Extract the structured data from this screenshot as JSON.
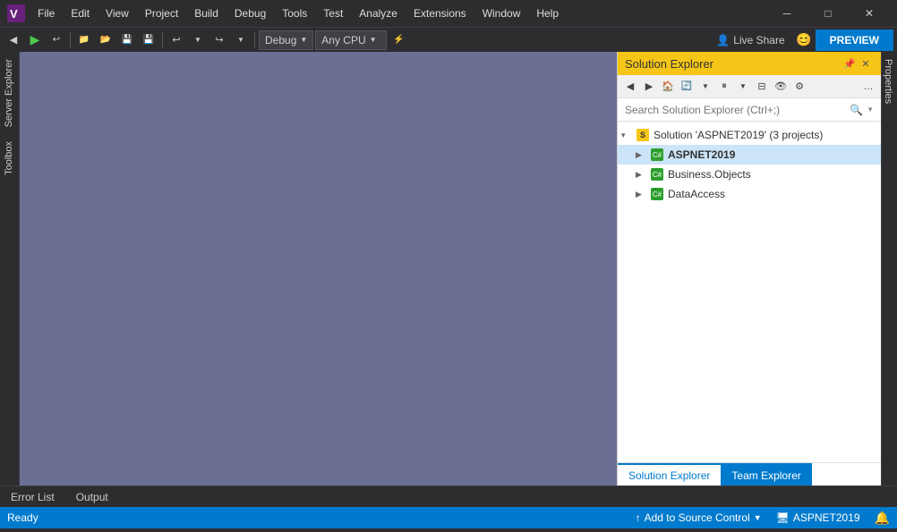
{
  "titleBar": {
    "menus": [
      "File",
      "Edit",
      "View",
      "Project",
      "Build",
      "Debug",
      "Tools",
      "Test",
      "Analyze",
      "Extensions",
      "Window",
      "Help"
    ],
    "controls": [
      "─",
      "□",
      "✕"
    ]
  },
  "toolbar": {
    "debugConfig": "Debug",
    "cpuConfig": "Any CPU",
    "liveShare": "Live Share",
    "preview": "PREVIEW"
  },
  "leftSidebar": {
    "tabs": [
      "Server Explorer",
      "Toolbox"
    ]
  },
  "rightSidebar": {
    "tabs": [
      "Properties"
    ]
  },
  "solutionExplorer": {
    "title": "Solution Explorer",
    "searchPlaceholder": "Search Solution Explorer (Ctrl+;)",
    "tree": [
      {
        "level": 0,
        "icon": "solution",
        "label": "Solution 'ASPNET2019' (3 projects)",
        "expanded": true,
        "bold": false
      },
      {
        "level": 1,
        "icon": "project",
        "label": "ASPNET2019",
        "expanded": false,
        "bold": true
      },
      {
        "level": 1,
        "icon": "project",
        "label": "Business.Objects",
        "expanded": false,
        "bold": false
      },
      {
        "level": 1,
        "icon": "project",
        "label": "DataAccess",
        "expanded": false,
        "bold": false
      }
    ],
    "bottomTabs": [
      {
        "label": "Solution Explorer",
        "active": true
      },
      {
        "label": "Team Explorer",
        "active": false
      }
    ]
  },
  "bottomTabs": [
    {
      "label": "Error List"
    },
    {
      "label": "Output"
    }
  ],
  "statusBar": {
    "ready": "Ready",
    "sourceControl": "Add to Source Control",
    "project": "ASPNET2019"
  }
}
